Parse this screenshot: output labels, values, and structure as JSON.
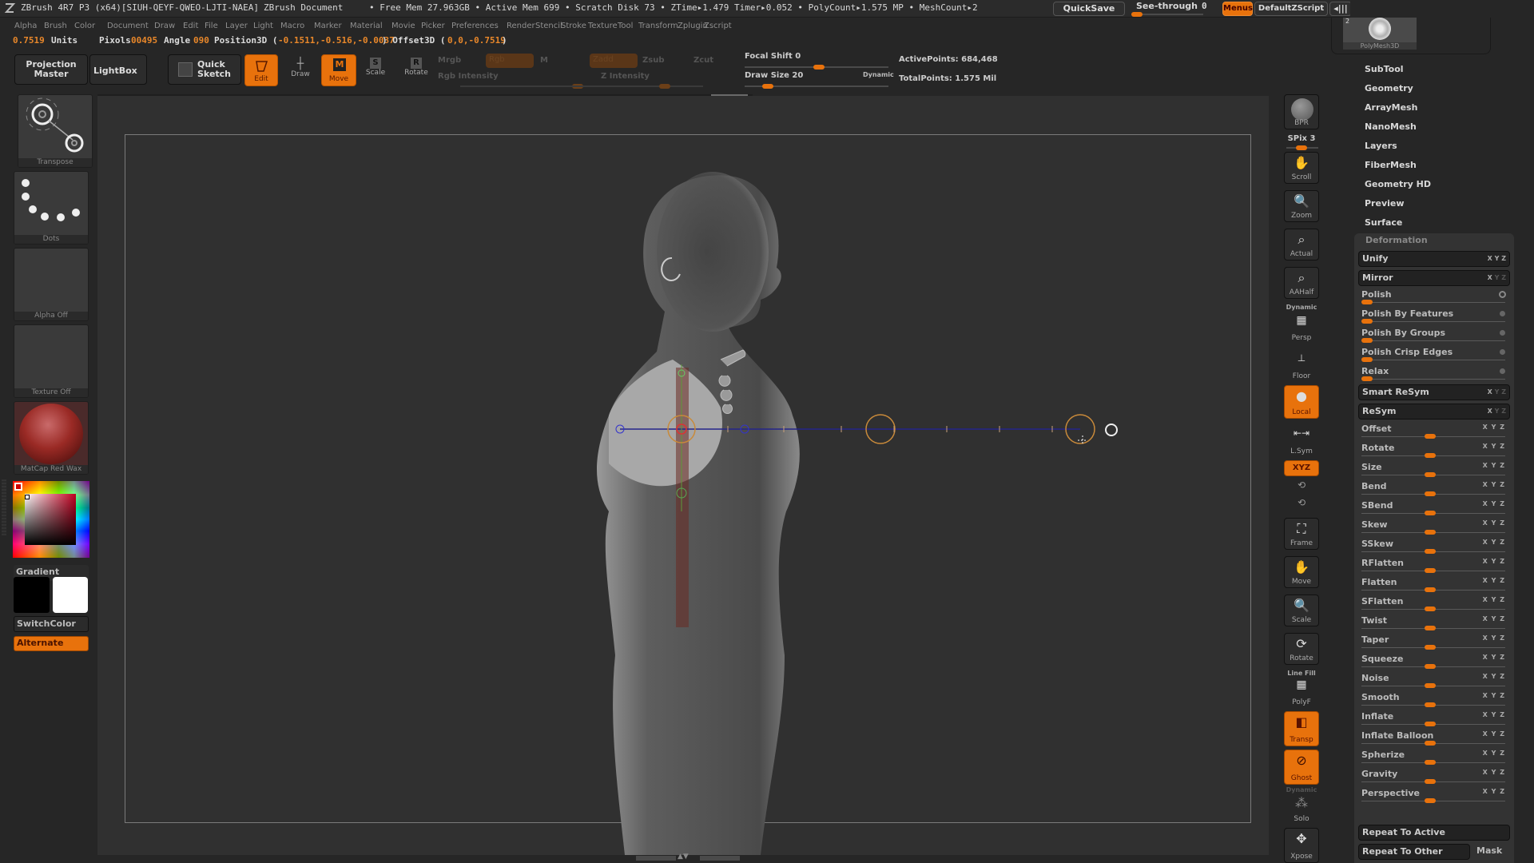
{
  "titlebar": {
    "app": "ZBrush 4R7 P3 (x64)[SIUH-QEYF-QWEO-LJTI-NAEA]",
    "document": "ZBrush Document",
    "stats": "• Free Mem 27.963GB • Active Mem 699 • Scratch Disk 73 •  ZTime▸1.479 Timer▸0.052 • PolyCount▸1.575 MP  • MeshCount▸2",
    "quicksave": "QuickSave",
    "see_through_label": "See-through",
    "see_through_value": "0",
    "menus": "Menus",
    "default_zscript": "DefaultZScript"
  },
  "menubar": [
    "Alpha",
    "Brush",
    "Color",
    "Document",
    "Draw",
    "Edit",
    "File",
    "Layer",
    "Light",
    "Macro",
    "Marker",
    "Material",
    "Movie",
    "Picker",
    "Preferences",
    "Render",
    "Stencil",
    "Stroke",
    "Texture",
    "Tool",
    "Transform",
    "Zplugin",
    "Zscript"
  ],
  "infoline": {
    "units_value": "0.7519",
    "units_label": "Units",
    "pixols_label": "Pixols",
    "pixols_value": "00495",
    "angle_label": "Angle",
    "angle_value": "090",
    "position_label": "Position3D (",
    "position_value": "-0.1511,-0.516,-0.0037",
    "offset_label": ") Offset3D (",
    "offset_value": "0,0,-0.7519",
    "close": ")"
  },
  "toolbar": {
    "projection_master": "Projection Master",
    "lightbox": "LightBox",
    "quick_sketch": "Quick Sketch",
    "edit": "Edit",
    "draw": "Draw",
    "move": "Move",
    "scale": "Scale",
    "rotate": "Rotate",
    "mrgb": "Mrgb",
    "rgb": "Rgb",
    "m": "M",
    "rgb_intensity": "Rgb Intensity",
    "zadd": "Zadd",
    "zsub": "Zsub",
    "zcut": "Zcut",
    "z_intensity": "Z Intensity",
    "focal_shift": "Focal Shift 0",
    "draw_size": "Draw Size 20",
    "dynamic": "Dynamic",
    "active_points": "ActivePoints: 684,468",
    "total_points": "TotalPoints: 1.575 Mil"
  },
  "leftpanel": {
    "brush": "Transpose",
    "stroke": "Dots",
    "alpha": "Alpha Off",
    "texture": "Texture Off",
    "material": "MatCap Red Wax",
    "gradient": "Gradient",
    "switch_color": "SwitchColor",
    "alternate": "Alternate",
    "main_color": "#000000",
    "secondary_color": "#ffffff"
  },
  "rshelf": {
    "bpr": "BPR",
    "spix": "SPix 3",
    "scroll": "Scroll",
    "zoom": "Zoom",
    "actual": "Actual",
    "aahalf": "AAHalf",
    "dynamic": "Dynamic",
    "persp": "Persp",
    "floor": "Floor",
    "local": "Local",
    "lsym": "L.Sym",
    "xyz": "XYZ",
    "frame": "Frame",
    "move": "Move",
    "scale": "Scale",
    "rotate": "Rotate",
    "line_fill": "Line Fill",
    "polyf": "PolyF",
    "transp": "Transp",
    "ghost": "Ghost",
    "dynamic2": "Dynamic",
    "solo": "Solo",
    "xpose": "Xpose"
  },
  "rpanel": {
    "tool_thumb_label": "PolyMesh3D",
    "tool_thumb_count": "2",
    "menu": [
      "SubTool",
      "Geometry",
      "ArrayMesh",
      "NanoMesh",
      "Layers",
      "FiberMesh",
      "Geometry HD",
      "Preview",
      "Surface"
    ],
    "deformation": {
      "header": "Deformation",
      "unify": "Unify",
      "mirror": "Mirror",
      "polish_sliders": [
        {
          "name": "Polish",
          "value": 0
        },
        {
          "name": "Polish By Features",
          "value": 0
        },
        {
          "name": "Polish By Groups",
          "value": 0
        },
        {
          "name": "Polish Crisp Edges",
          "value": 0
        },
        {
          "name": "Relax",
          "value": 0
        }
      ],
      "smart_resym": "Smart ReSym",
      "resym": "ReSym",
      "sliders": [
        {
          "name": "Offset",
          "axes": "X Y Z",
          "value": 0
        },
        {
          "name": "Rotate",
          "axes": "X Y Z",
          "value": 0
        },
        {
          "name": "Size",
          "axes": "X Y Z",
          "value": 0
        },
        {
          "name": "Bend",
          "axes": "X Y Z",
          "value": 0
        },
        {
          "name": "SBend",
          "axes": "X Y Z",
          "value": 0
        },
        {
          "name": "Skew",
          "axes": "X Y Z",
          "value": 0
        },
        {
          "name": "SSkew",
          "axes": "X Y Z",
          "value": 0
        },
        {
          "name": "RFlatten",
          "axes": "X Y Z",
          "value": 0
        },
        {
          "name": "Flatten",
          "axes": "X Y Z",
          "value": 0
        },
        {
          "name": "SFlatten",
          "axes": "X Y Z",
          "value": 0
        },
        {
          "name": "Twist",
          "axes": "X Y Z",
          "value": 0
        },
        {
          "name": "Taper",
          "axes": "X Y Z",
          "value": 0
        },
        {
          "name": "Squeeze",
          "axes": "X Y Z",
          "value": 0
        },
        {
          "name": "Noise",
          "axes": "X Y Z",
          "value": 0
        },
        {
          "name": "Smooth",
          "axes": "X Y Z",
          "value": 0
        },
        {
          "name": "Inflate",
          "axes": "X Y Z",
          "value": 0
        },
        {
          "name": "Inflate Balloon",
          "axes": "X Y Z",
          "value": 0
        },
        {
          "name": "Spherize",
          "axes": "X Y Z",
          "value": 0
        },
        {
          "name": "Gravity",
          "axes": "X Y Z",
          "value": 0
        },
        {
          "name": "Perspective",
          "axes": "X Y Z",
          "value": 0
        }
      ],
      "repeat_to_active": "Repeat To Active",
      "repeat_to_other": "Repeat To Other",
      "mask": "Mask"
    }
  },
  "colors": {
    "accent": "#e8720c",
    "panel": "#262626",
    "canvas": "#303030"
  }
}
